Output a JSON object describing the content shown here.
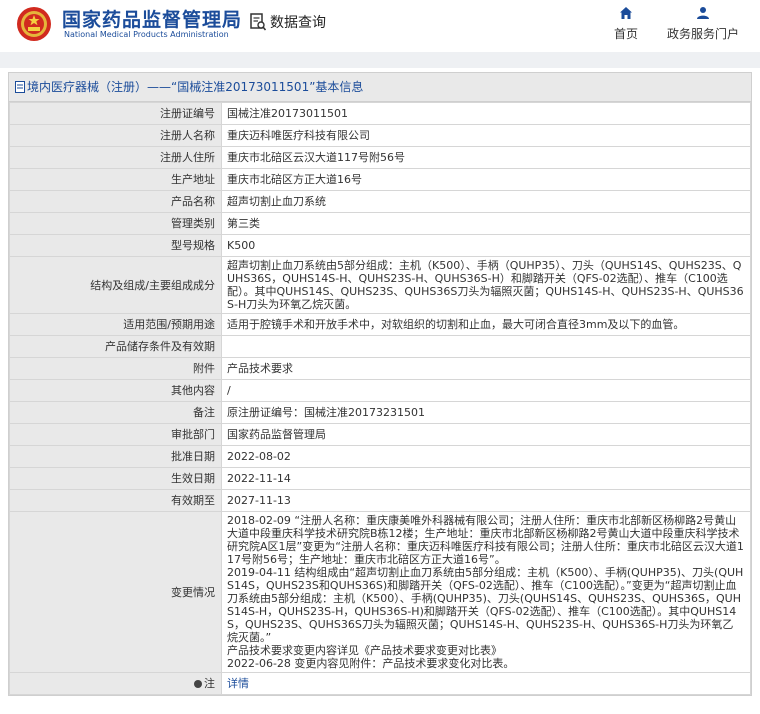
{
  "header": {
    "brand_cn": "国家药品监督管理局",
    "brand_en": "National Medical Products Administration",
    "query_title": "数据查询",
    "nav": {
      "home": "首页",
      "portal": "政务服务门户"
    }
  },
  "panel": {
    "title": "境内医疗器械（注册）——“国械注准20173011501”基本信息"
  },
  "rows": [
    {
      "label": "注册证编号",
      "value": "国械注准20173011501"
    },
    {
      "label": "注册人名称",
      "value": "重庆迈科唯医疗科技有限公司"
    },
    {
      "label": "注册人住所",
      "value": "重庆市北碚区云汉大道117号附56号"
    },
    {
      "label": "生产地址",
      "value": "重庆市北碚区方正大道16号"
    },
    {
      "label": "产品名称",
      "value": "超声切割止血刀系统"
    },
    {
      "label": "管理类别",
      "value": "第三类"
    },
    {
      "label": "型号规格",
      "value": "K500"
    },
    {
      "label": "结构及组成/主要组成成分",
      "value": "超声切割止血刀系统由5部分组成：主机（K500）、手柄（QUHP35）、刀头（QUHS14S、QUHS23S、QUHS36S，QUHS14S-H、QUHS23S-H、QUHS36S-H）和脚踏开关（QFS-02选配）、推车（C100选配）。其中QUHS14S、QUHS23S、QUHS36S刀头为辐照灭菌；QUHS14S-H、QUHS23S-H、QUHS36S-H刀头为环氧乙烷灭菌。"
    },
    {
      "label": "适用范围/预期用途",
      "value": "适用于腔镜手术和开放手术中，对软组织的切割和止血，最大可闭合直径3mm及以下的血管。"
    },
    {
      "label": "产品储存条件及有效期",
      "value": ""
    },
    {
      "label": "附件",
      "value": "产品技术要求"
    },
    {
      "label": "其他内容",
      "value": "/"
    },
    {
      "label": "备注",
      "value": "原注册证编号：国械注准20173231501"
    },
    {
      "label": "审批部门",
      "value": "国家药品监督管理局"
    },
    {
      "label": "批准日期",
      "value": "2022-08-02"
    },
    {
      "label": "生效日期",
      "value": "2022-11-14"
    },
    {
      "label": "有效期至",
      "value": "2027-11-13"
    },
    {
      "label": "变更情况",
      "value": "2018-02-09 “注册人名称：重庆康美唯外科器械有限公司；注册人住所：重庆市北部新区杨柳路2号黄山大道中段重庆科学技术研究院B栋12楼；生产地址：重庆市北部新区杨柳路2号黄山大道中段重庆科学技术研究院A区1层”变更为“注册人名称：重庆迈科唯医疗科技有限公司；注册人住所：重庆市北碚区云汉大道117号附56号；生产地址：重庆市北碚区方正大道16号”。\n2019-04-11 结构组成由“超声切割止血刀系统由5部分组成：主机（K500）、手柄(QUHP35)、刀头(QUHS14S，QUHS23S和QUHS36S)和脚踏开关（QFS-02选配）、推车（C100选配）。”变更为“超声切割止血刀系统由5部分组成：主机（K500）、手柄(QUHP35)、刀头(QUHS14S、QUHS23S、QUHS36S，QUHS14S-H，QUHS23S-H，QUHS36S-H)和脚踏开关（QFS-02选配）、推车（C100选配）。其中QUHS14S，QUHS23S、QUHS36S刀头为辐照灭菌；QUHS14S-H、QUHS23S-H、QUHS36S-H刀头为环氧乙烷灭菌。”\n产品技术要求变更内容详见《产品技术要求变更对比表》\n2022-06-28 变更内容见附件：产品技术要求变化对比表。"
    }
  ],
  "note": {
    "label": "注",
    "link": "详情"
  }
}
